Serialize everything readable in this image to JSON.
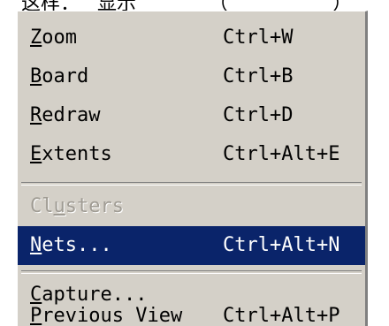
{
  "top_fragment": {
    "part_a": "这样：",
    "part_b": "显示",
    "part_c": "（",
    "part_d": "）"
  },
  "menu": {
    "items": [
      {
        "mnemonic": "Z",
        "rest": "oom",
        "shortcut": "Ctrl+W",
        "state": "normal"
      },
      {
        "mnemonic": "B",
        "rest": "oard",
        "shortcut": "Ctrl+B",
        "state": "normal"
      },
      {
        "mnemonic": "R",
        "rest": "edraw",
        "shortcut": "Ctrl+D",
        "state": "normal"
      },
      {
        "mnemonic": "E",
        "rest": "xtents",
        "shortcut": "Ctrl+Alt+E",
        "state": "normal"
      },
      {
        "pre": "Cl",
        "mnemonic": "u",
        "rest": "sters",
        "shortcut": "",
        "state": "disabled"
      },
      {
        "mnemonic": "N",
        "rest": "ets...",
        "shortcut": "Ctrl+Alt+N",
        "state": "highlighted"
      },
      {
        "mnemonic": "C",
        "rest": "apture...",
        "shortcut": "",
        "state": "normal"
      },
      {
        "mnemonic": "P",
        "rest": "revious View",
        "shortcut": "Ctrl+Alt+P",
        "state": "normal"
      }
    ],
    "colors": {
      "menu_background": "#d4d0c8",
      "highlight_background": "#0a246a",
      "highlight_text": "#ffffff",
      "disabled_text": "#a09c94"
    }
  }
}
